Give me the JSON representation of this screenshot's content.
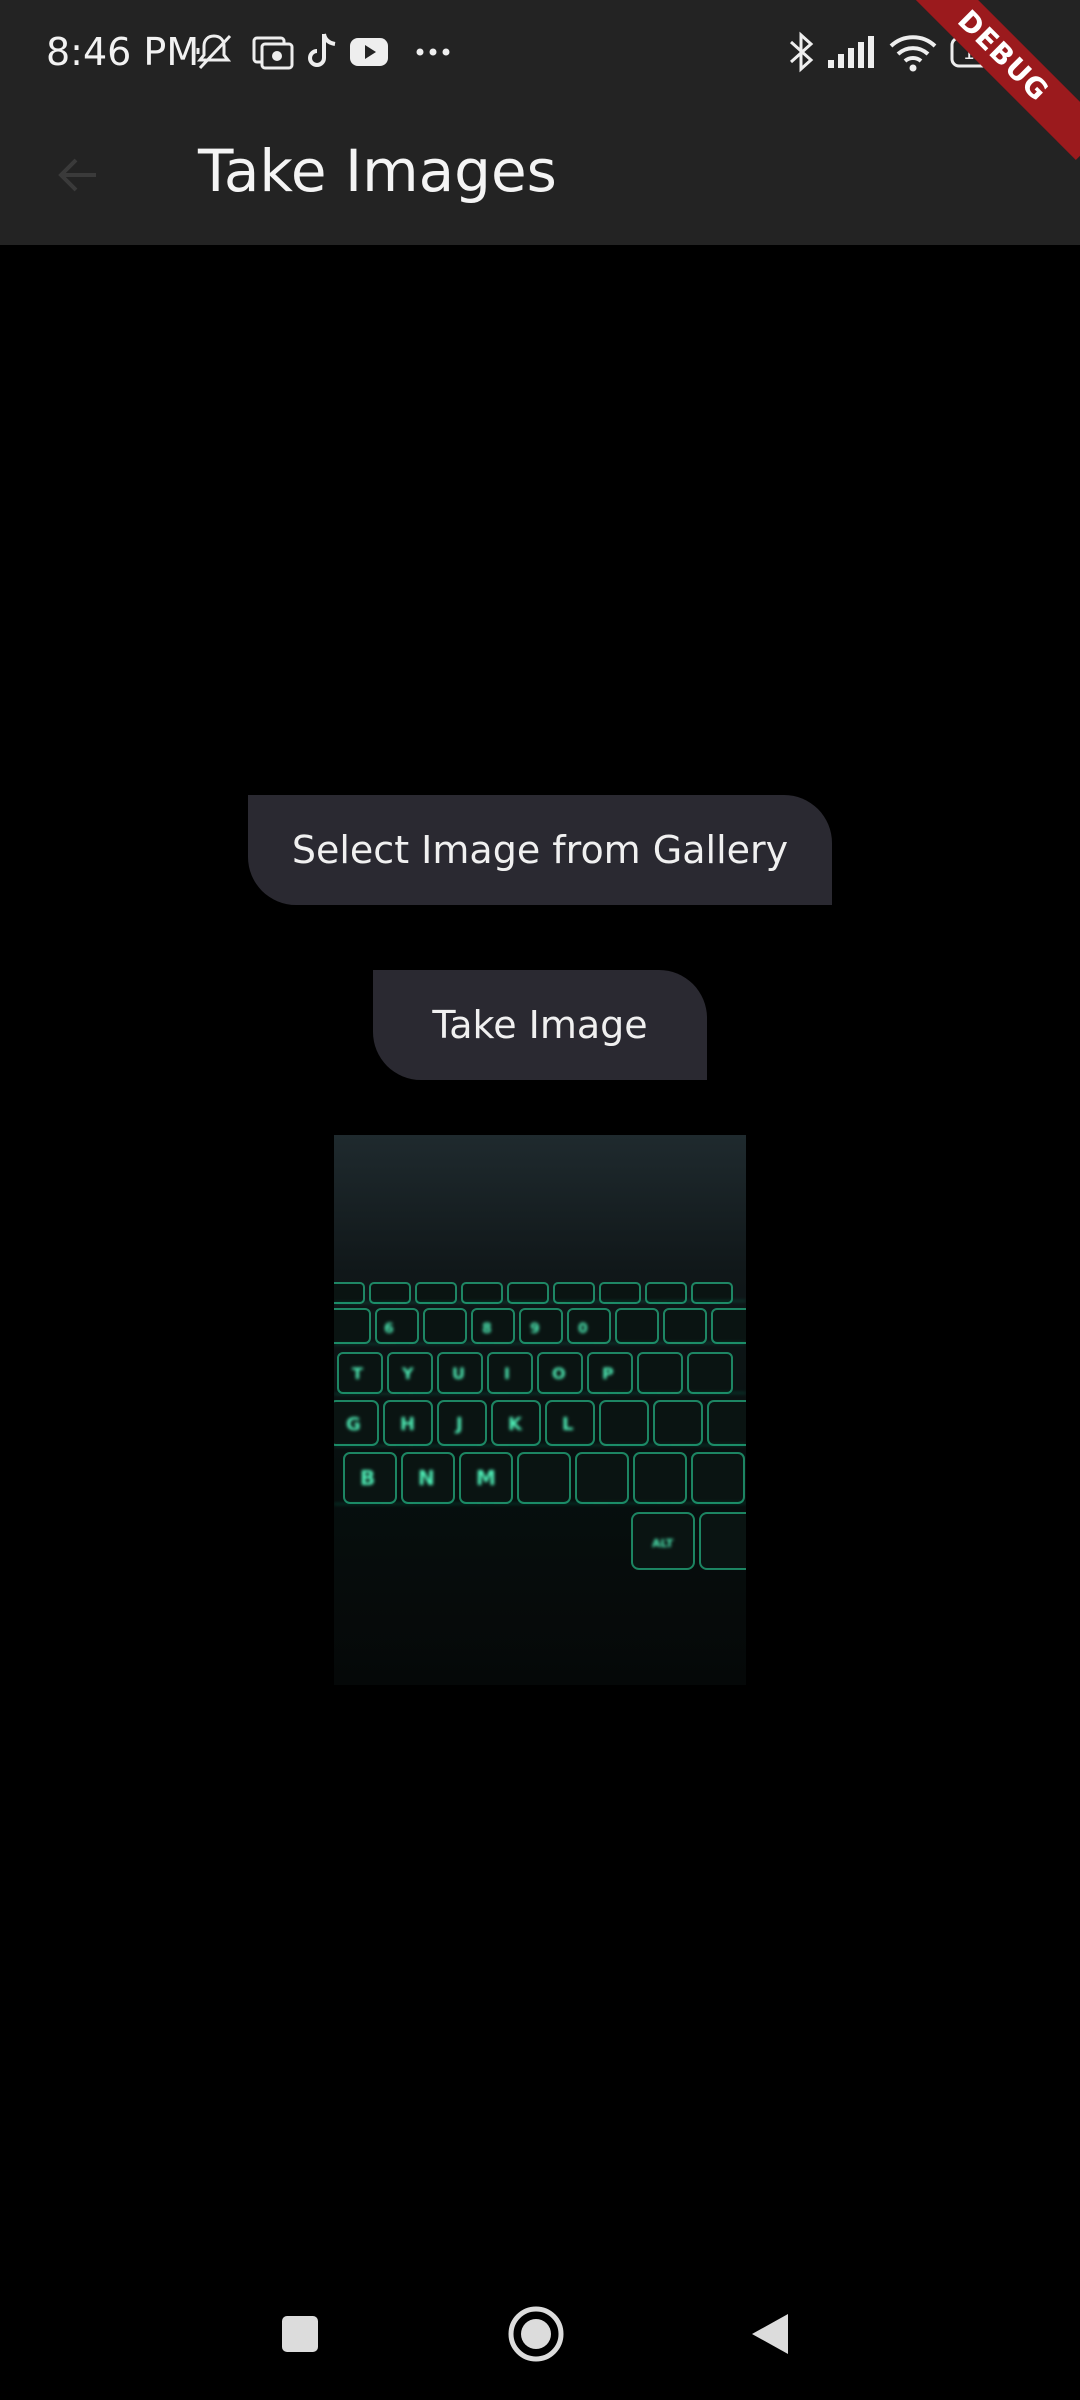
{
  "status_bar": {
    "time": "8:46 PM",
    "left_icons": [
      "mute-vibrate-icon",
      "photo-notification-icon",
      "tiktok-icon",
      "youtube-icon",
      "more-dots-icon"
    ],
    "right_icons": [
      "bluetooth-icon",
      "signal-icon",
      "wifi-icon",
      "battery-icon"
    ],
    "battery_level": "100"
  },
  "app_bar": {
    "title": "Take Images",
    "back_icon": "back-arrow-icon",
    "debug_banner": "DEBUG",
    "background": "#232323"
  },
  "main": {
    "gallery_button_label": "Select Image from Gallery",
    "take_button_label": "Take Image",
    "button_color": "#2a2931",
    "image_subject": "keyboard-photo",
    "keyboard_key_color": "#2de4a6"
  },
  "nav_bar": {
    "items": [
      "recents-square-icon",
      "home-circle-icon",
      "back-triangle-icon"
    ]
  }
}
